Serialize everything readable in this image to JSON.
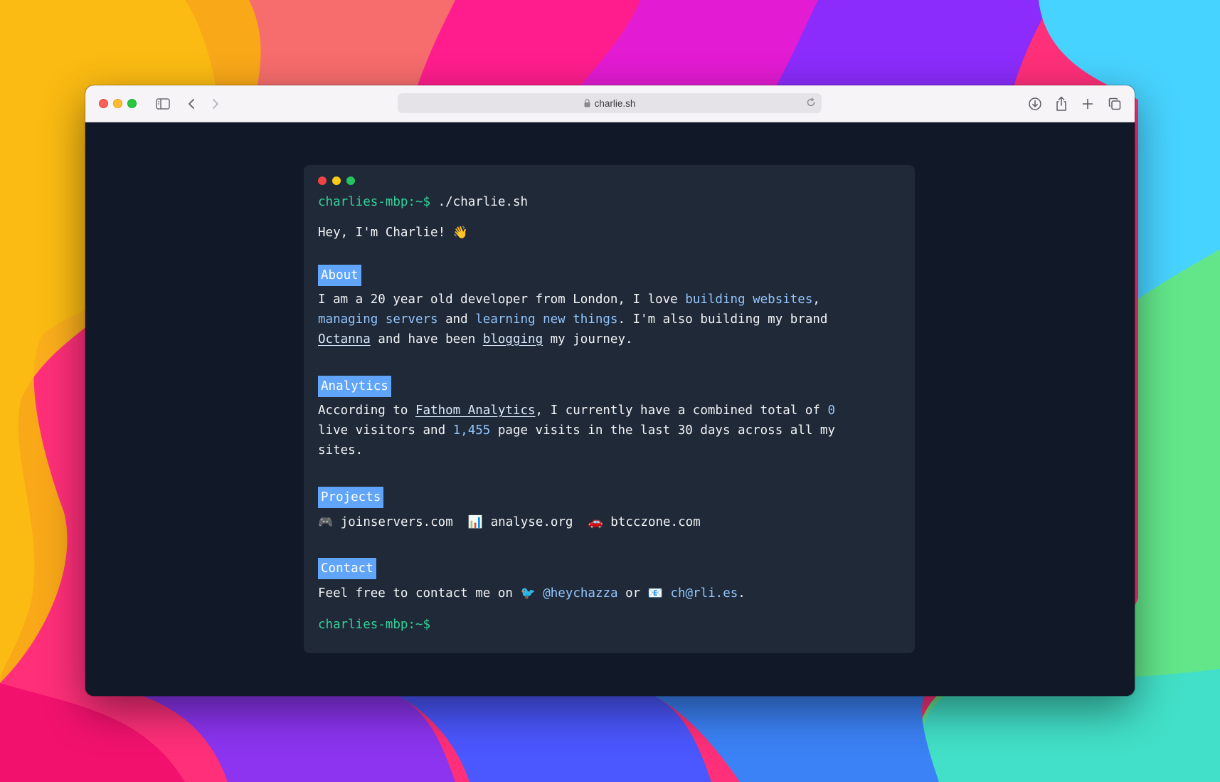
{
  "browser": {
    "url": "charlie.sh"
  },
  "terminal": {
    "prompt": "charlies-mbp:~$",
    "command": "./charlie.sh",
    "greeting": "Hey, I'm Charlie!",
    "greeting_emoji": "👋",
    "about": {
      "title": "About",
      "text_1": "I am a 20 year old developer from London, I love ",
      "link_building": "building websites",
      "text_2": ",",
      "link_managing": "managing servers",
      "text_3": " and ",
      "link_learning": "learning new things",
      "text_4": ". I'm also building my brand",
      "link_octanna": "Octanna",
      "text_5": " and have been ",
      "link_blogging": "blogging",
      "text_6": " my journey."
    },
    "analytics": {
      "title": "Analytics",
      "text_1": "According to ",
      "link_fathom": "Fathom Analytics",
      "text_2": ", I currently have a combined total of ",
      "live_visitors": "0",
      "text_3": "live visitors and ",
      "page_visits": "1,455",
      "text_4": " page visits in the last 30 days across all my",
      "text_5": "sites."
    },
    "projects": {
      "title": "Projects",
      "items": [
        {
          "emoji": "🎮",
          "label": "joinservers.com"
        },
        {
          "emoji": "📊",
          "label": "analyse.org"
        },
        {
          "emoji": "🚗",
          "label": "btcczone.com"
        }
      ]
    },
    "contact": {
      "title": "Contact",
      "text_1": "Feel free to contact me on ",
      "twitter_emoji": "🐦",
      "twitter": "@heychazza",
      "text_2": " or ",
      "email_emoji": "📧",
      "email": "ch@rli.es",
      "text_3": "."
    }
  }
}
